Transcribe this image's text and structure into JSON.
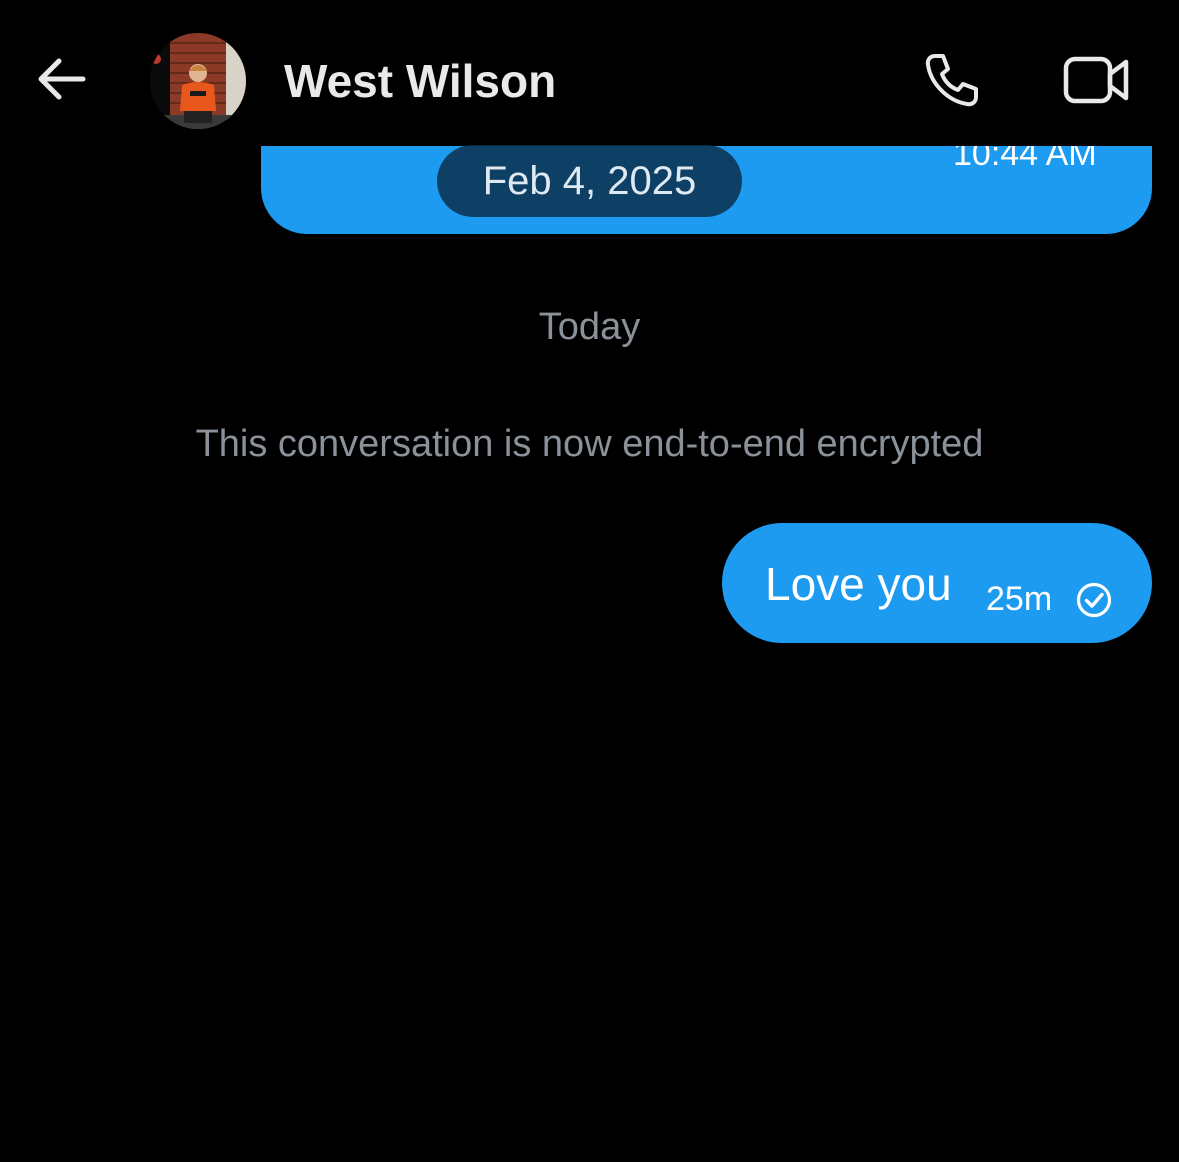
{
  "header": {
    "back_icon": "arrow-left-icon",
    "contact_name": "West Wilson",
    "avatar": "contact-avatar",
    "call_icon": "phone-icon",
    "video_icon": "video-camera-icon"
  },
  "previous_message": {
    "date_label": "Feb 4, 2025",
    "time": "10:44 AM",
    "bubble_color": "#1d9bf0"
  },
  "thread": {
    "day_separator": "Today",
    "system_note": "This conversation is now end-to-end encrypted"
  },
  "message": {
    "text": "Love you",
    "time": "25m",
    "status_icon": "check-circle-icon",
    "bubble_color": "#1d9bf0"
  },
  "colors": {
    "background": "#000000",
    "accent": "#1d9bf0",
    "muted_text": "#8b9198"
  }
}
